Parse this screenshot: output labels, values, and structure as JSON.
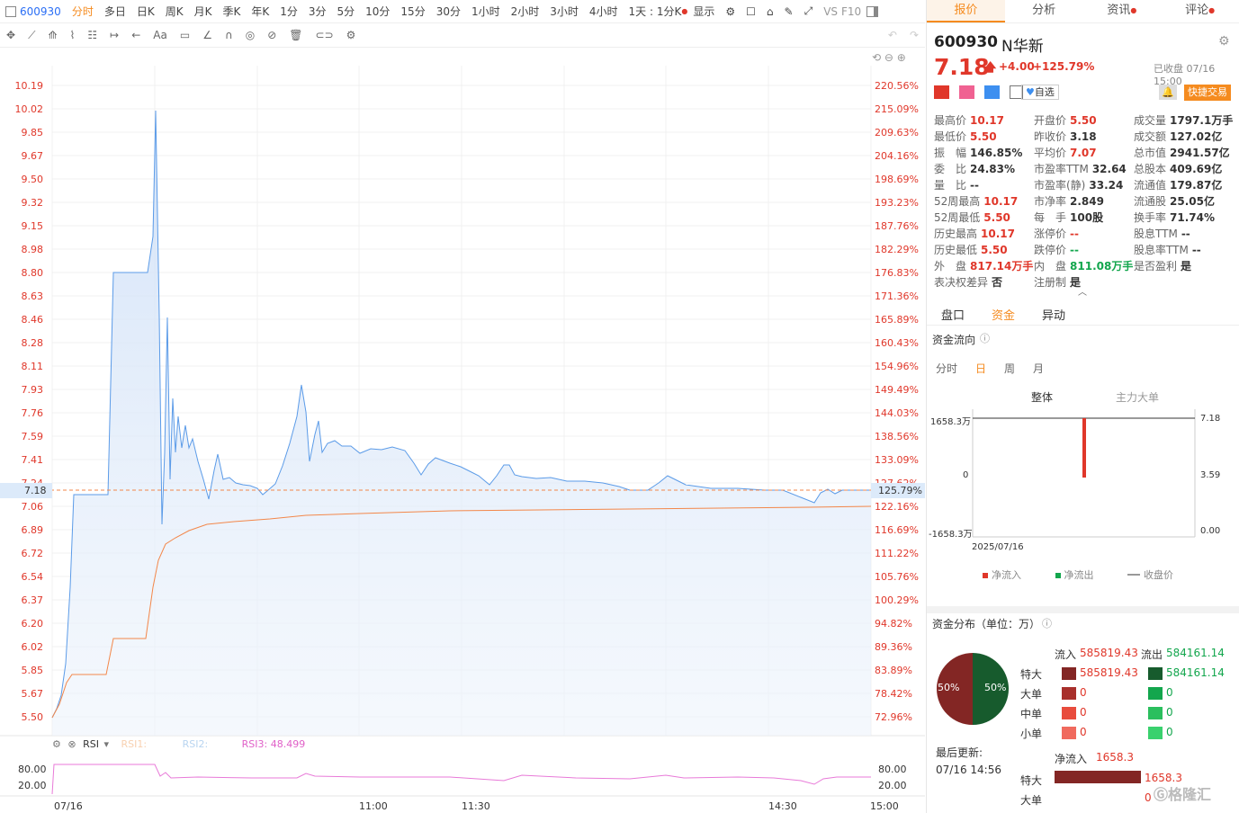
{
  "toolbar": {
    "code": "600930",
    "periods": [
      "分时",
      "多日",
      "日K",
      "周K",
      "月K",
      "季K",
      "年K",
      "1分",
      "3分",
      "5分",
      "10分",
      "15分",
      "30分",
      "1小时",
      "2小时",
      "3小时",
      "4小时"
    ],
    "active": "分时",
    "one_day": "1天 : 1分K",
    "display": "显示",
    "vs": "VS",
    "f10": "F10"
  },
  "chart": {
    "left_axis": [
      "10.19",
      "10.02",
      "9.85",
      "9.67",
      "9.50",
      "9.32",
      "9.15",
      "8.98",
      "8.80",
      "8.63",
      "8.46",
      "8.28",
      "8.11",
      "7.93",
      "7.76",
      "7.59",
      "7.41",
      "7.24",
      "7.06",
      "6.89",
      "6.72",
      "6.54",
      "6.37",
      "6.20",
      "6.02",
      "5.85",
      "5.67",
      "5.50"
    ],
    "right_axis": [
      "220.56%",
      "215.09%",
      "209.63%",
      "204.16%",
      "198.69%",
      "193.23%",
      "187.76%",
      "182.29%",
      "176.83%",
      "171.36%",
      "165.89%",
      "160.43%",
      "154.96%",
      "149.49%",
      "144.03%",
      "138.56%",
      "133.09%",
      "127.62%",
      "122.16%",
      "116.69%",
      "111.22%",
      "105.76%",
      "100.29%",
      "94.82%",
      "89.36%",
      "83.89%",
      "78.42%",
      "72.96%"
    ],
    "cur_price": "7.18",
    "cur_pct": "125.79%",
    "x_labels": [
      "07/16",
      "11:00",
      "11:30",
      "14:30",
      "15:00"
    ],
    "rsi_name": "RSI",
    "rsi1": "RSI1:",
    "rsi2": "RSI2:",
    "rsi3": "RSI3:",
    "rsi3_val": "48.499",
    "rsi_axis": [
      "80.00",
      "20.00"
    ]
  },
  "panel": {
    "tabs": [
      "报价",
      "分析",
      "资讯",
      "评论"
    ],
    "code": "600930",
    "name": "N华新",
    "price": "7.18",
    "change": "+4.00",
    "pct": "+125.79%",
    "status": "已收盘 07/16 15:00",
    "fav": "自选",
    "trade": "快捷交易",
    "quotes": [
      {
        "k": "最高价",
        "v": "10.17",
        "c": "red"
      },
      {
        "k": "开盘价",
        "v": "5.50",
        "c": "red"
      },
      {
        "k": "成交量",
        "v": "1797.1万手",
        "c": ""
      },
      {
        "k": "最低价",
        "v": "5.50",
        "c": "red"
      },
      {
        "k": "昨收价",
        "v": "3.18",
        "c": ""
      },
      {
        "k": "成交额",
        "v": "127.02亿",
        "c": ""
      },
      {
        "k": "振　幅",
        "v": "146.85%",
        "c": ""
      },
      {
        "k": "平均价",
        "v": "7.07",
        "c": "red"
      },
      {
        "k": "总市值",
        "v": "2941.57亿",
        "c": ""
      },
      {
        "k": "委　比",
        "v": "24.83%",
        "c": ""
      },
      {
        "k": "市盈率TTM",
        "v": "32.64",
        "c": ""
      },
      {
        "k": "总股本",
        "v": "409.69亿",
        "c": ""
      },
      {
        "k": "量　比",
        "v": "--",
        "c": ""
      },
      {
        "k": "市盈率(静)",
        "v": "33.24",
        "c": ""
      },
      {
        "k": "流通值",
        "v": "179.87亿",
        "c": ""
      },
      {
        "k": "52周最高",
        "v": "10.17",
        "c": "red"
      },
      {
        "k": "市净率",
        "v": "2.849",
        "c": ""
      },
      {
        "k": "流通股",
        "v": "25.05亿",
        "c": ""
      },
      {
        "k": "52周最低",
        "v": "5.50",
        "c": "red"
      },
      {
        "k": "每　手",
        "v": "100股",
        "c": ""
      },
      {
        "k": "换手率",
        "v": "71.74%",
        "c": ""
      },
      {
        "k": "历史最高",
        "v": "10.17",
        "c": "red"
      },
      {
        "k": "涨停价",
        "v": "--",
        "c": "red"
      },
      {
        "k": "股息TTM",
        "v": "--",
        "c": ""
      },
      {
        "k": "历史最低",
        "v": "5.50",
        "c": "red"
      },
      {
        "k": "跌停价",
        "v": "--",
        "c": "green"
      },
      {
        "k": "股息率TTM",
        "v": "--",
        "c": ""
      },
      {
        "k": "外　盘",
        "v": "817.14万手",
        "c": "red"
      },
      {
        "k": "内　盘",
        "v": "811.08万手",
        "c": "green"
      },
      {
        "k": "是否盈利",
        "v": "是",
        "c": ""
      },
      {
        "k": "表决权差异",
        "v": "否",
        "c": ""
      },
      {
        "k": "注册制",
        "v": "是",
        "c": ""
      }
    ],
    "sub_tabs": [
      "盘口",
      "资金",
      "异动"
    ],
    "sub_active": "资金",
    "flow_title": "资金流向",
    "flow_periods": [
      "分时",
      "日",
      "周",
      "月"
    ],
    "flow_active": "日",
    "flow_modes": [
      "整体",
      "主力大单"
    ],
    "flow_left_axis": [
      "1658.3万",
      "0",
      "-1658.3万"
    ],
    "flow_right_axis": [
      "7.18",
      "3.59",
      "0.00"
    ],
    "flow_date": "2025/07/16",
    "legend": [
      "净流入",
      "净流出",
      "收盘价"
    ],
    "dist_title": "资金分布（单位：万）",
    "in_label": "流入",
    "in_total": "585819.43",
    "out_label": "流出",
    "out_total": "584161.14",
    "pie_left": "50%",
    "pie_right": "50%",
    "rows": [
      {
        "k": "特大",
        "in": "585819.43",
        "out": "584161.14"
      },
      {
        "k": "大单",
        "in": "0",
        "out": "0"
      },
      {
        "k": "中单",
        "in": "0",
        "out": "0"
      },
      {
        "k": "小单",
        "in": "0",
        "out": "0"
      }
    ],
    "updated_label": "最后更新:",
    "updated": "07/16 14:56",
    "net_label": "净流入",
    "net_val": "1658.3",
    "net_rows": [
      {
        "k": "特大",
        "v": "1658.3"
      },
      {
        "k": "大单",
        "v": "0"
      }
    ],
    "watermark": "格隆汇"
  }
}
